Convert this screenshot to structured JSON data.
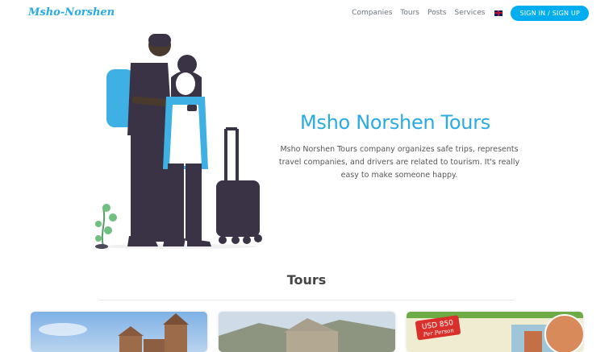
{
  "header": {
    "logo": "Msho-Norshen",
    "nav": [
      {
        "label": "Companies"
      },
      {
        "label": "Tours"
      },
      {
        "label": "Posts"
      },
      {
        "label": "Services"
      }
    ],
    "language_flag": "uk-flag-icon",
    "signin_label": "SIGN IN / SIGN UP"
  },
  "hero": {
    "title": "Msho Norshen Tours",
    "description": "Msho Norshen Tours company organizes safe trips, represents travel companies, and drivers are related to tourism. It's really easy to make someone happy."
  },
  "tours_section": {
    "title": "Tours",
    "cards": [
      {
        "image": "church-photo"
      },
      {
        "image": "ruins-photo"
      },
      {
        "image": "promo-photo",
        "price_badge_line1": "USD 850",
        "price_badge_line2": "Per Person"
      }
    ]
  },
  "colors": {
    "accent": "#29abe2",
    "button": "#00aeef",
    "text": "#555555",
    "figure_dark": "#3a3346",
    "backpack": "#3fb0e4"
  }
}
